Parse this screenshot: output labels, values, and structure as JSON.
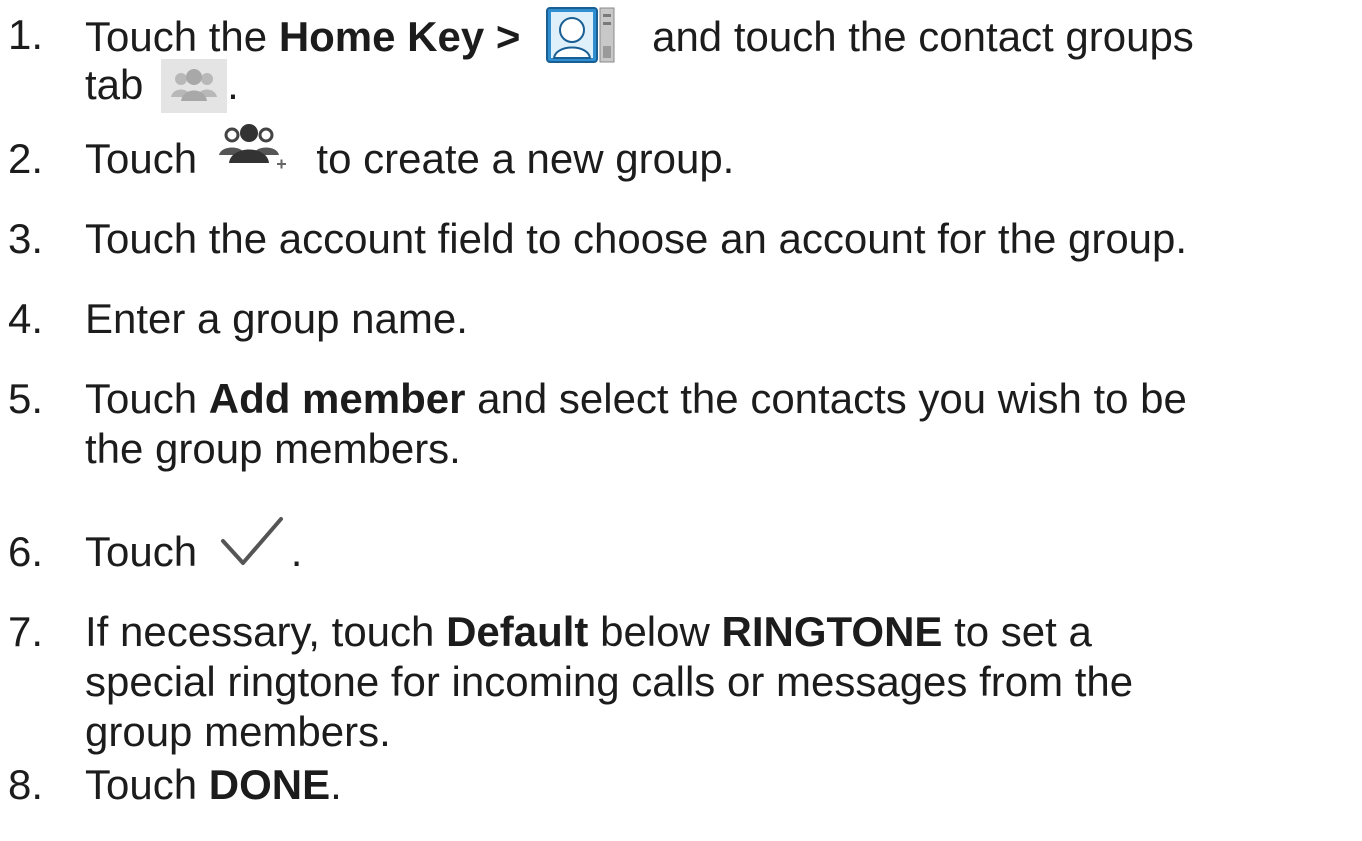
{
  "steps": [
    {
      "number": "1.",
      "segments": {
        "a": "Touch the ",
        "b": "Home Key >",
        "c": " and touch the contact groups",
        "d": "tab ",
        "e": "."
      },
      "icons": [
        "contacts-app-icon",
        "contact-groups-tab-icon"
      ]
    },
    {
      "number": "2.",
      "segments": {
        "a": "Touch ",
        "b": " to create a new group."
      },
      "icons": [
        "new-group-icon"
      ]
    },
    {
      "number": "3.",
      "segments": {
        "a": "Touch the account field to choose an account for the group."
      }
    },
    {
      "number": "4.",
      "segments": {
        "a": "Enter a group name."
      }
    },
    {
      "number": "5.",
      "segments": {
        "a": "Touch ",
        "b": "Add member",
        "c": " and select the contacts you wish to be",
        "d": "the group members."
      }
    },
    {
      "number": "6.",
      "segments": {
        "a": "Touch ",
        "b": "."
      },
      "icons": [
        "checkmark-icon"
      ]
    },
    {
      "number": "7.",
      "segments": {
        "a": "If necessary, touch ",
        "b": "Default",
        "c": " below ",
        "d": "RINGTONE",
        "e": " to set a",
        "f": "special ringtone for incoming calls or messages from the",
        "g": "group members."
      }
    },
    {
      "number": "8.",
      "segments": {
        "a": "Touch ",
        "b": "DONE",
        "c": "."
      }
    }
  ],
  "colors": {
    "text": "#1c1c1c",
    "contacts_icon_blue": "#2f8fd0",
    "icon_gray": "#555555",
    "tab_icon_bg": "#e4e4e4"
  }
}
